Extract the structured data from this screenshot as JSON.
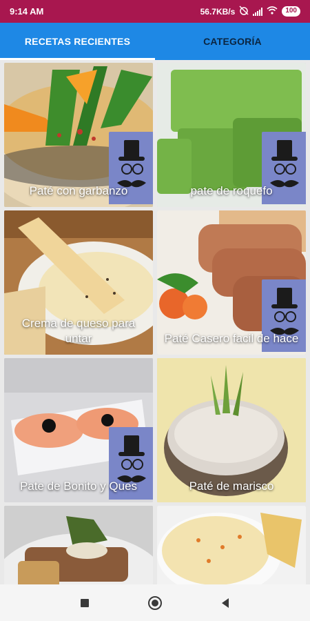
{
  "status": {
    "time": "9:14 AM",
    "speed": "56.7KB/s",
    "battery": "100"
  },
  "tabs": [
    {
      "label": "RECETAS RECIENTES",
      "active": true
    },
    {
      "label": "CATEGORÍA",
      "active": false
    }
  ],
  "recipes": [
    {
      "title": "Paté con garbanzo"
    },
    {
      "title": "pate de roquefo"
    },
    {
      "title": "Crema de queso para untar"
    },
    {
      "title": "Paté Casero facil de hace"
    },
    {
      "title": "Pate de Bonito y Ques"
    },
    {
      "title": "Paté de marisco"
    },
    {
      "title": ""
    },
    {
      "title": ""
    }
  ],
  "icons": {
    "badge": "mustache-top-hat-icon",
    "nav": [
      "square-recents-icon",
      "circle-home-icon",
      "triangle-back-icon"
    ]
  }
}
